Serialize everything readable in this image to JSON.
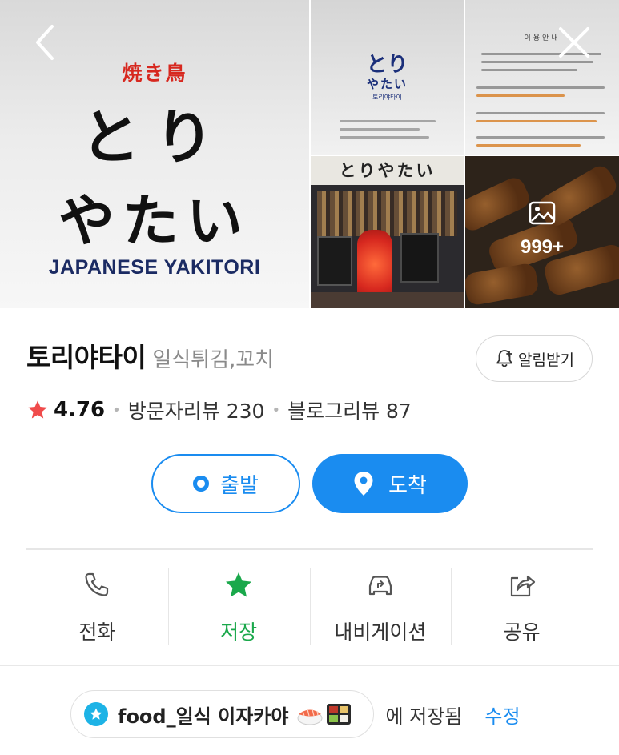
{
  "photos": {
    "main": {
      "yakitori_kanji": "焼き鳥",
      "logo_line1": "とり",
      "logo_line2": "やたい",
      "logo_en": "JAPANESE YAKITORI"
    },
    "tile_menu": {
      "logo_line1": "とり",
      "logo_line2": "やたい",
      "logo_kr": "토리야타이"
    },
    "tile_notice": {
      "title": "이용안내"
    },
    "tile_storefront": {
      "sign": "とりやたい"
    },
    "tile_gallery": {
      "more_count": "999+",
      "icon": "gallery-icon"
    }
  },
  "header": {
    "back_icon": "chevron-left-icon",
    "close_icon": "close-icon"
  },
  "place": {
    "name": "토리야타이",
    "category": "일식튀김,꼬치",
    "notify_label": "알림받기"
  },
  "rating": {
    "score": "4.76",
    "visitor_reviews": "방문자리뷰 230",
    "blog_reviews": "블로그리뷰 87"
  },
  "route": {
    "start_label": "출발",
    "arrive_label": "도착"
  },
  "actions": [
    {
      "label": "전화",
      "icon": "phone-icon"
    },
    {
      "label": "저장",
      "icon": "star-icon"
    },
    {
      "label": "내비게이션",
      "icon": "navigation-car-icon"
    },
    {
      "label": "공유",
      "icon": "share-icon"
    }
  ],
  "saved": {
    "folder_name": "food_일식 이자카야",
    "suffix": "에 저장됨",
    "edit_label": "수정"
  },
  "colors": {
    "accent": "#1a8cf0",
    "saved_green": "#1aa84b",
    "star_red": "#f04b4b",
    "folder_icon": "#1db3e6"
  }
}
